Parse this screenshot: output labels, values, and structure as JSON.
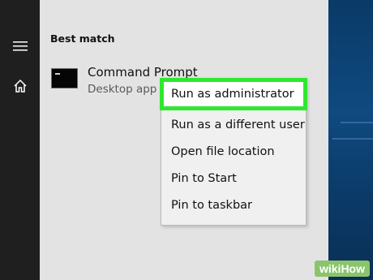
{
  "search_panel": {
    "section_title": "Best match",
    "result": {
      "title": "Command Prompt",
      "subtitle": "Desktop app"
    }
  },
  "context_menu": {
    "items": [
      {
        "label": "Run as administrator",
        "highlighted": true
      },
      {
        "label": "Run as a different user"
      },
      {
        "label": "Open file location"
      },
      {
        "label": "Pin to Start"
      },
      {
        "label": "Pin to taskbar"
      }
    ]
  },
  "watermark": "wikiHow",
  "colors": {
    "highlight_border": "#2ee82e",
    "panel_bg": "#e3e3e3",
    "rail_bg": "#1f1f1f"
  },
  "icons": {
    "rail_menu": "hamburger-icon",
    "rail_home": "home-icon",
    "result_icon": "command-prompt-icon"
  }
}
